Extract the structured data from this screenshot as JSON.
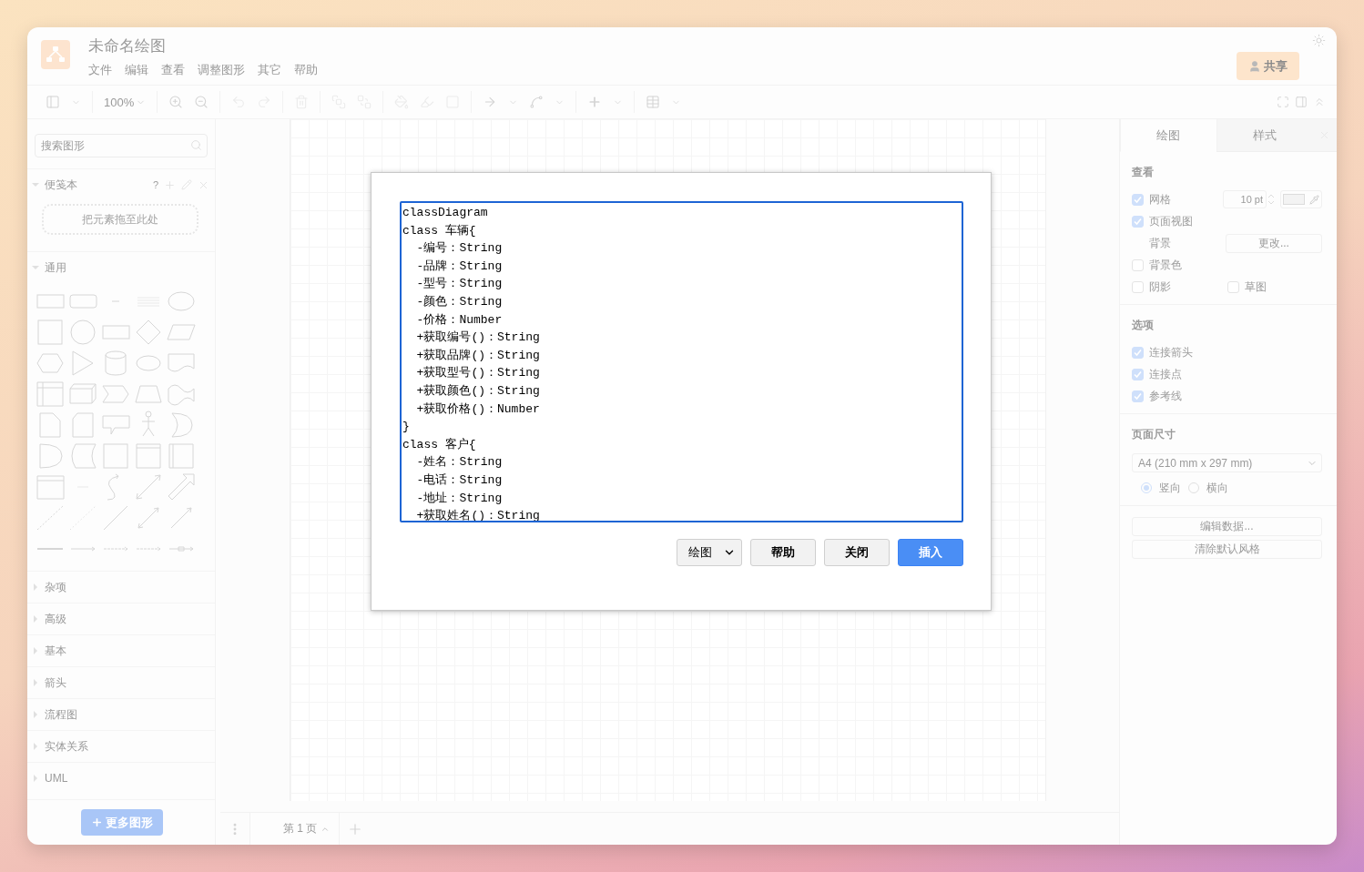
{
  "window": {
    "title": "未命名绘图"
  },
  "menu": [
    "文件",
    "编辑",
    "查看",
    "调整图形",
    "其它",
    "帮助"
  ],
  "share_button": "共享",
  "toolbar": {
    "zoom": "100%"
  },
  "sidebar": {
    "search": {
      "placeholder": "搜索图形"
    },
    "scratchpad": {
      "title": "便笺本",
      "expanded": true,
      "help": "?",
      "drop_hint": "把元素拖至此处"
    },
    "sections": [
      {
        "label": "通用",
        "expanded": true
      },
      {
        "label": "杂项",
        "expanded": false
      },
      {
        "label": "高级",
        "expanded": false
      },
      {
        "label": "基本",
        "expanded": false
      },
      {
        "label": "箭头",
        "expanded": false
      },
      {
        "label": "流程图",
        "expanded": false
      },
      {
        "label": "实体关系",
        "expanded": false
      },
      {
        "label": "UML",
        "expanded": false
      }
    ],
    "more_button": "更多图形"
  },
  "page_tabs": [
    {
      "label": "第 1 页",
      "selected": true
    }
  ],
  "format_panel": {
    "tabs": [
      {
        "label": "绘图",
        "selected": true
      },
      {
        "label": "样式",
        "selected": false
      }
    ],
    "view": {
      "title": "查看",
      "grid": {
        "label": "网格",
        "checked": true
      },
      "grid_size": "10 pt",
      "page_view": {
        "label": "页面视图",
        "checked": true
      },
      "background": {
        "label": "背景",
        "button": "更改..."
      },
      "background_color": {
        "label": "背景色",
        "checked": false
      },
      "shadow": {
        "label": "阴影",
        "checked": false
      },
      "sketch": {
        "label": "草图",
        "checked": false
      }
    },
    "options": {
      "title": "选项",
      "items": [
        {
          "label": "连接箭头",
          "checked": true
        },
        {
          "label": "连接点",
          "checked": true
        },
        {
          "label": "参考线",
          "checked": true
        }
      ]
    },
    "paper": {
      "title": "页面尺寸",
      "size": "A4 (210 mm x 297 mm)",
      "orientations": [
        {
          "label": "竖向",
          "selected": true
        },
        {
          "label": "横向",
          "selected": false
        }
      ]
    },
    "buttons": [
      "编辑数据...",
      "清除默认风格"
    ]
  },
  "dialog": {
    "text": "classDiagram\nclass 车辆{\n  -编号：String\n  -品牌：String\n  -型号：String\n  -颜色：String\n  -价格：Number\n  +获取编号()：String\n  +获取品牌()：String\n  +获取型号()：String\n  +获取颜色()：String\n  +获取价格()：Number\n}\nclass 客户{\n  -姓名：String\n  -电话：String\n  -地址：String\n  +获取姓名()：String",
    "type_select": "绘图",
    "buttons": [
      {
        "label": "帮助",
        "kind": "plain"
      },
      {
        "label": "关闭",
        "kind": "plain"
      },
      {
        "label": "插入",
        "kind": "primary"
      }
    ]
  }
}
